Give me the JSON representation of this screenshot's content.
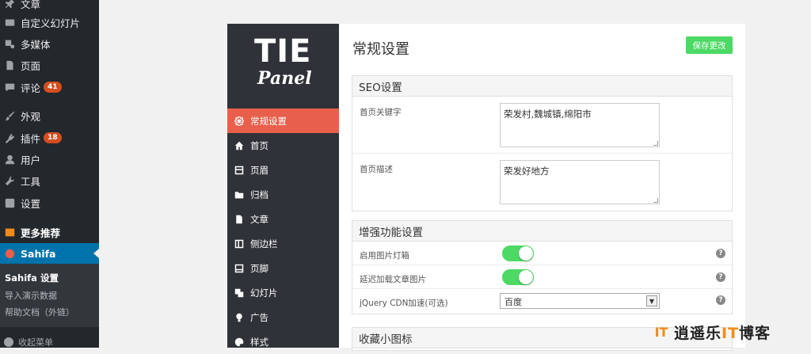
{
  "wp_menu": {
    "items": [
      {
        "label": "文章",
        "icon": "pin-icon"
      },
      {
        "label": "自定义幻灯片",
        "icon": "slides-icon"
      },
      {
        "label": "多媒体",
        "icon": "media-icon"
      },
      {
        "label": "页面",
        "icon": "page-icon"
      },
      {
        "label": "评论",
        "icon": "comment-icon",
        "badge": "41"
      },
      {
        "label": "外观",
        "icon": "brush-icon"
      },
      {
        "label": "插件",
        "icon": "plugin-icon",
        "badge": "18"
      },
      {
        "label": "用户",
        "icon": "user-icon"
      },
      {
        "label": "工具",
        "icon": "wrench-icon"
      },
      {
        "label": "设置",
        "icon": "settings-icon"
      }
    ],
    "more": "更多推荐",
    "active": "Sahifa",
    "submenu": [
      "Sahifa 设置",
      "导入演示数据",
      "帮助文档（外链）"
    ],
    "collapse": "收起菜单"
  },
  "panel": {
    "logo_top": "TIE",
    "logo_bottom": "Panel",
    "menu": [
      {
        "label": "常规设置",
        "icon": "gear-icon",
        "active": true
      },
      {
        "label": "首页",
        "icon": "home-icon"
      },
      {
        "label": "页眉",
        "icon": "header-icon"
      },
      {
        "label": "归档",
        "icon": "folder-icon"
      },
      {
        "label": "文章",
        "icon": "document-icon"
      },
      {
        "label": "侧边栏",
        "icon": "sidebar-icon"
      },
      {
        "label": "页脚",
        "icon": "footer-icon"
      },
      {
        "label": "幻灯片",
        "icon": "slideshow-icon"
      },
      {
        "label": "广告",
        "icon": "bulb-icon"
      },
      {
        "label": "样式",
        "icon": "palette-icon"
      }
    ]
  },
  "main": {
    "title": "常规设置",
    "save_label": "保存更改",
    "seo": {
      "title": "SEO设置",
      "keywords_label": "首页关键字",
      "keywords_value": "荣发村,魏城镇,绵阳市",
      "desc_label": "首页描述",
      "desc_value": "荣发好地方"
    },
    "enhance": {
      "title": "增强功能设置",
      "lightbox_label": "启用图片灯箱",
      "lightbox_on": true,
      "lazyload_label": "延迟加载文章图片",
      "lazyload_on": true,
      "cdn_label": "jQuery CDN加速(可选)",
      "cdn_value": "百度",
      "help": "?"
    },
    "favicon_title": "收藏小图标"
  },
  "watermark": {
    "logo": "IT",
    "text_1": "逍遥乐",
    "text_it": "IT",
    "text_2": "博客"
  },
  "colors": {
    "wp_bg": "#23282d",
    "wp_active": "#0073aa",
    "panel_side": "#2f3238",
    "panel_active": "#e8604c",
    "toggle_on": "#4cd964",
    "badge": "#d54e21"
  }
}
